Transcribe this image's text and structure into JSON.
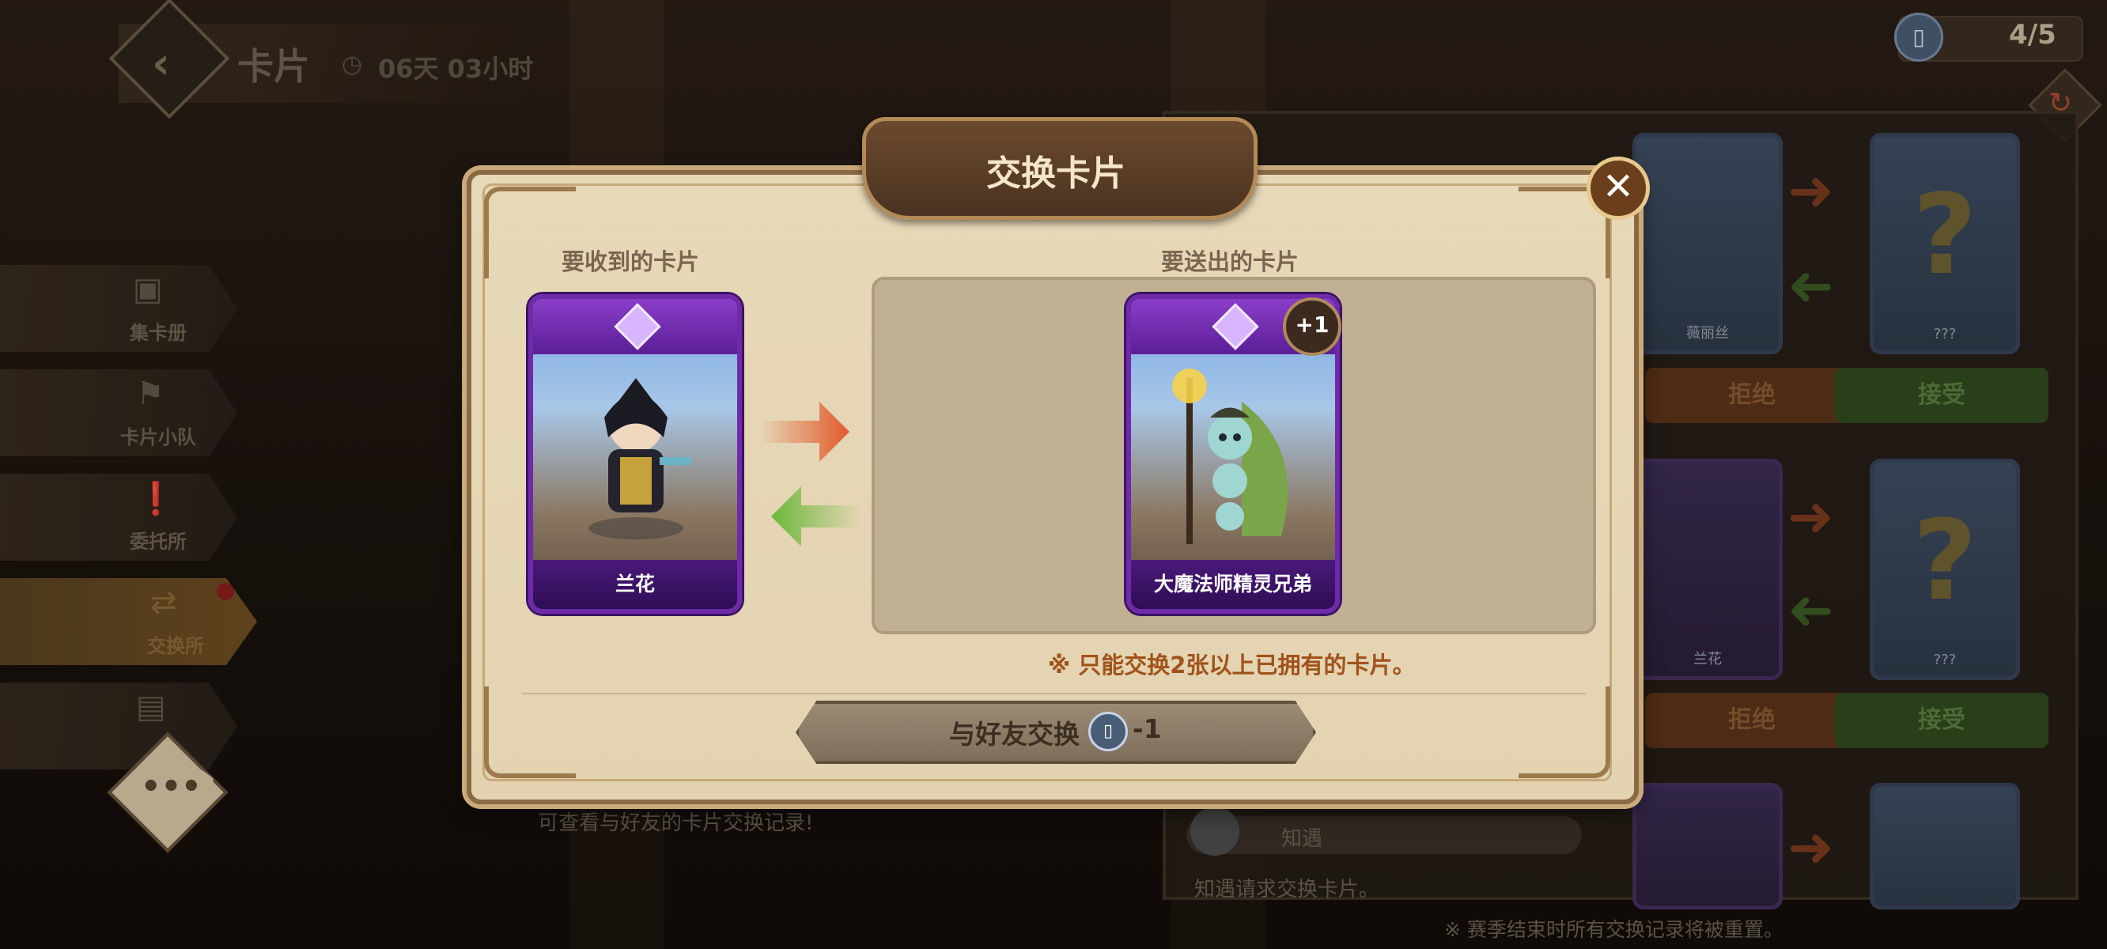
{
  "header": {
    "title": "卡片",
    "timer": "06天 03小时"
  },
  "ticket": {
    "count": "4/5"
  },
  "sidebar": {
    "items": [
      {
        "label": "集卡册",
        "icon": "album-icon"
      },
      {
        "label": "卡片小队",
        "icon": "flag-icon"
      },
      {
        "label": "委托所",
        "icon": "notice-icon"
      },
      {
        "label": "交换所",
        "icon": "exchange-icon"
      }
    ]
  },
  "right_panel": {
    "rows": [
      {
        "card_label": "薇丽丝",
        "unknown_label": "???",
        "reject": "拒绝",
        "accept": "接受"
      },
      {
        "card_label": "兰花",
        "unknown_label": "???",
        "reject": "拒绝",
        "accept": "接受"
      }
    ],
    "friend_name": "知遇",
    "friend_request": "知遇请求交换卡片。",
    "footer_note": "※ 赛季结束时所有交换记录将被重置。"
  },
  "bg_hint": "可查看与好友的卡片交换记录!",
  "modal": {
    "title": "交换卡片",
    "receive_label": "要收到的卡片",
    "send_label": "要送出的卡片",
    "receive_card": {
      "name": "兰花"
    },
    "send_card": {
      "name": "大魔法师精灵兄弟",
      "badge": "+1"
    },
    "note": "※ 只能交换2张以上已拥有的卡片。",
    "exchange_button": {
      "label": "与好友交换",
      "cost": "-1"
    }
  },
  "colors": {
    "accent_red": "#e25a2a",
    "accent_green": "#6bb83a",
    "card_purple": "#6e2aa8",
    "panel_parchment": "#e6d7b6"
  }
}
